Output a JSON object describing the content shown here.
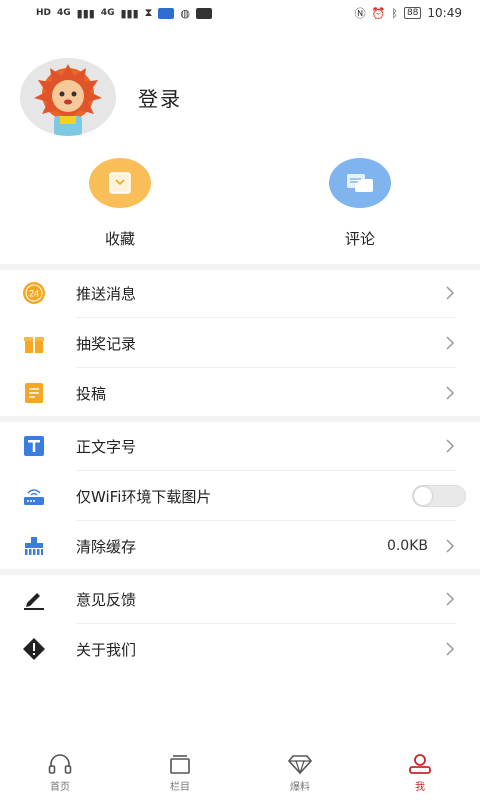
{
  "status_bar": {
    "left_chips": [
      "HD",
      "4G",
      "4G"
    ],
    "battery": "88",
    "time": "10:49"
  },
  "profile": {
    "login_label": "登录"
  },
  "quick_actions": [
    {
      "label": "收藏",
      "icon": "favorites-icon",
      "color": "#f9be58"
    },
    {
      "label": "评论",
      "icon": "comment-icon",
      "color": "#7fb4ee"
    }
  ],
  "menu": {
    "group1": [
      {
        "label": "推送消息",
        "icon": "push-24-icon"
      },
      {
        "label": "抽奖记录",
        "icon": "gift-icon"
      },
      {
        "label": "投稿",
        "icon": "submit-doc-icon"
      }
    ],
    "group2": [
      {
        "label": "正文字号",
        "icon": "font-size-icon"
      },
      {
        "label": "仅WiFi环境下载图片",
        "icon": "router-icon",
        "toggle_on": false
      },
      {
        "label": "清除缓存",
        "icon": "clear-cache-icon",
        "value": "0.0KB"
      }
    ],
    "group3": [
      {
        "label": "意见反馈",
        "icon": "feedback-pen-icon"
      },
      {
        "label": "关于我们",
        "icon": "about-diamond-icon"
      }
    ]
  },
  "push_badge": "24",
  "bottom_nav": [
    {
      "label": "首页",
      "icon": "headphones-icon",
      "active": false
    },
    {
      "label": "栏目",
      "icon": "columns-icon",
      "active": false
    },
    {
      "label": "爆料",
      "icon": "diamond-icon",
      "active": false
    },
    {
      "label": "我",
      "icon": "user-icon",
      "active": true
    }
  ],
  "colors": {
    "accent": "#c62828",
    "orange": "#f5a623",
    "blue": "#3a7de0"
  }
}
